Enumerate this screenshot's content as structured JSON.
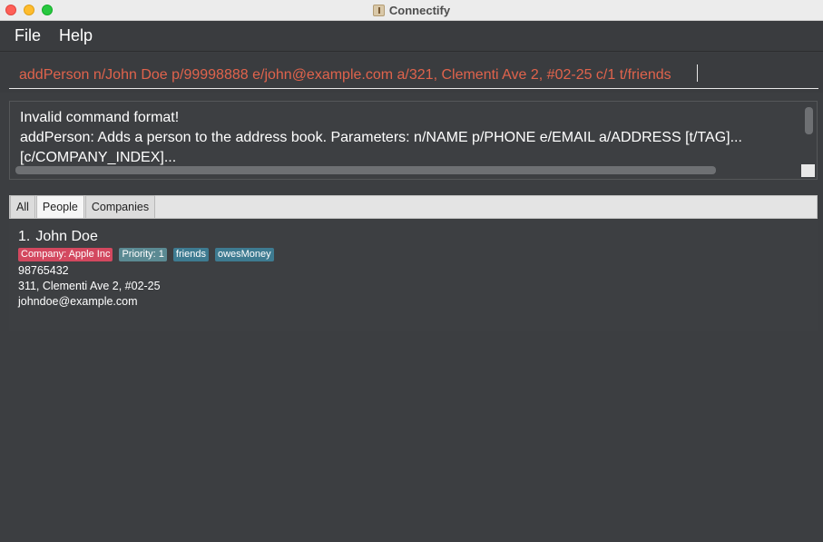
{
  "window": {
    "title": "Connectify"
  },
  "menu": {
    "file": "File",
    "help": "Help"
  },
  "command": {
    "value": "addPerson n/John Doe p/99998888 e/john@example.com a/321, Clementi Ave 2, #02-25 c/1 t/friends"
  },
  "result": {
    "line1": "Invalid command format!",
    "line2": "addPerson: Adds a person to the address book. Parameters: n/NAME p/PHONE e/EMAIL a/ADDRESS [t/TAG]...",
    "line3": "[c/COMPANY_INDEX]..."
  },
  "tabs": [
    {
      "label": "All",
      "active": false
    },
    {
      "label": "People",
      "active": true
    },
    {
      "label": "Companies",
      "active": false
    }
  ],
  "persons": [
    {
      "index": "1.",
      "name": "John Doe",
      "tags": [
        {
          "label": "Company: Apple Inc",
          "kind": "company",
          "color": "#d3485f"
        },
        {
          "label": "Priority: 1",
          "kind": "priority",
          "color": "#5b8a93"
        },
        {
          "label": "friends",
          "kind": "plain",
          "color": "#3e7b91"
        },
        {
          "label": "owesMoney",
          "kind": "plain",
          "color": "#3e7b91"
        }
      ],
      "phone": "98765432",
      "address": "311, Clementi Ave 2, #02-25",
      "email": "johndoe@example.com"
    }
  ],
  "colors": {
    "background": "#3c3e41",
    "command_text": "#e0634c",
    "accent_company": "#d3485f"
  },
  "icons": {
    "app": "connectify-app-icon"
  }
}
